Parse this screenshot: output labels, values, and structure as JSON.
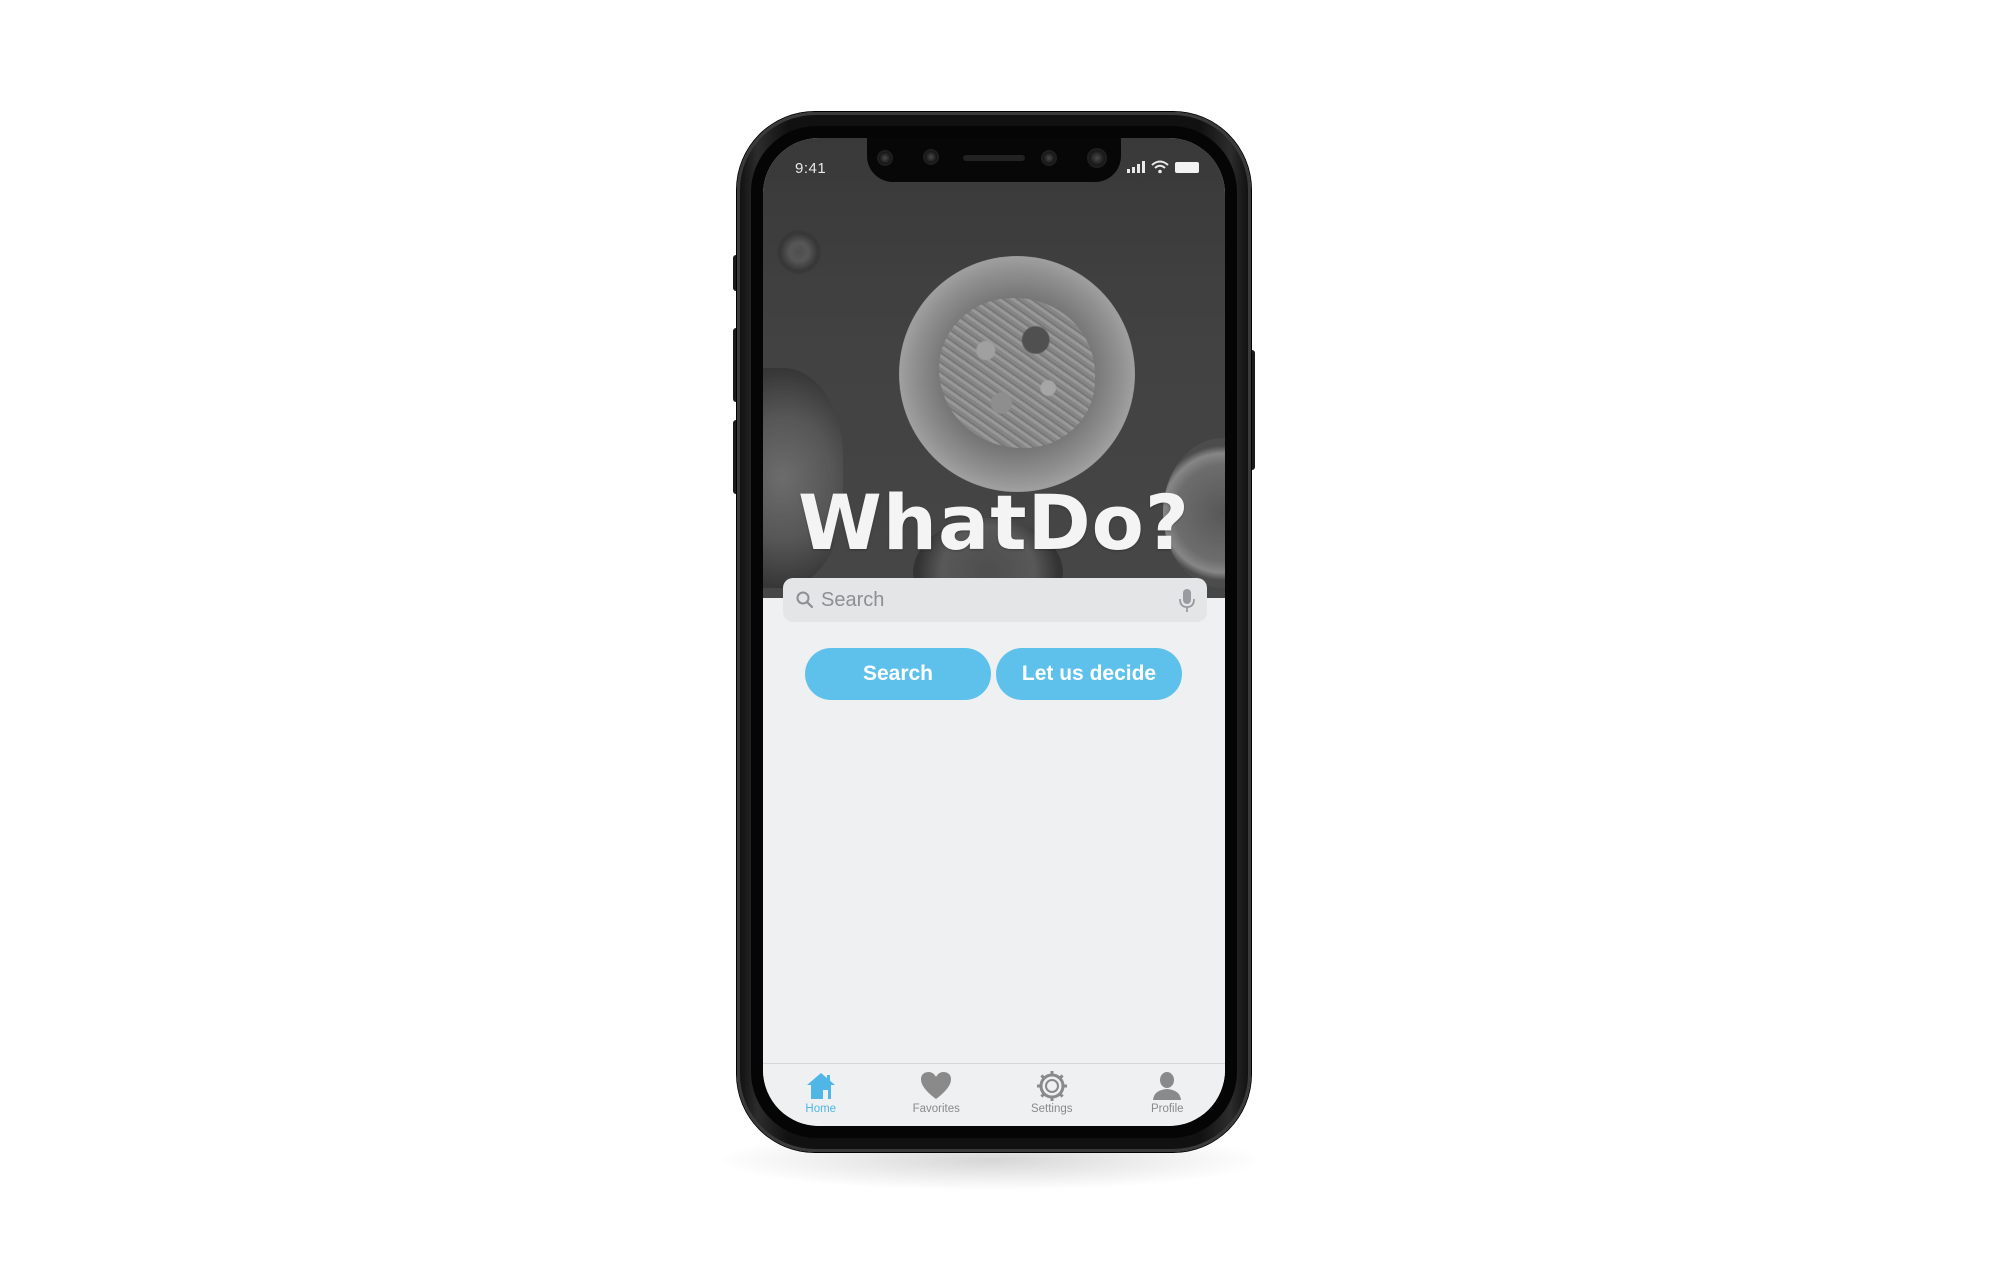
{
  "status_bar": {
    "time": "9:41"
  },
  "app": {
    "title": "WhatDo?"
  },
  "search": {
    "placeholder": "Search",
    "value": ""
  },
  "actions": {
    "search_label": "Search",
    "decide_label": "Let us decide"
  },
  "tab_bar": {
    "items": [
      {
        "label": "Home",
        "icon": "home-icon",
        "active": true
      },
      {
        "label": "Favorites",
        "icon": "heart-icon",
        "active": false
      },
      {
        "label": "Settings",
        "icon": "gear-icon",
        "active": false
      },
      {
        "label": "Profile",
        "icon": "person-icon",
        "active": false
      }
    ]
  },
  "colors": {
    "accent": "#5ec1ec",
    "tab_active": "#4fb6e6",
    "tab_inactive": "#8a8a8a",
    "background": "#eef0f1"
  }
}
